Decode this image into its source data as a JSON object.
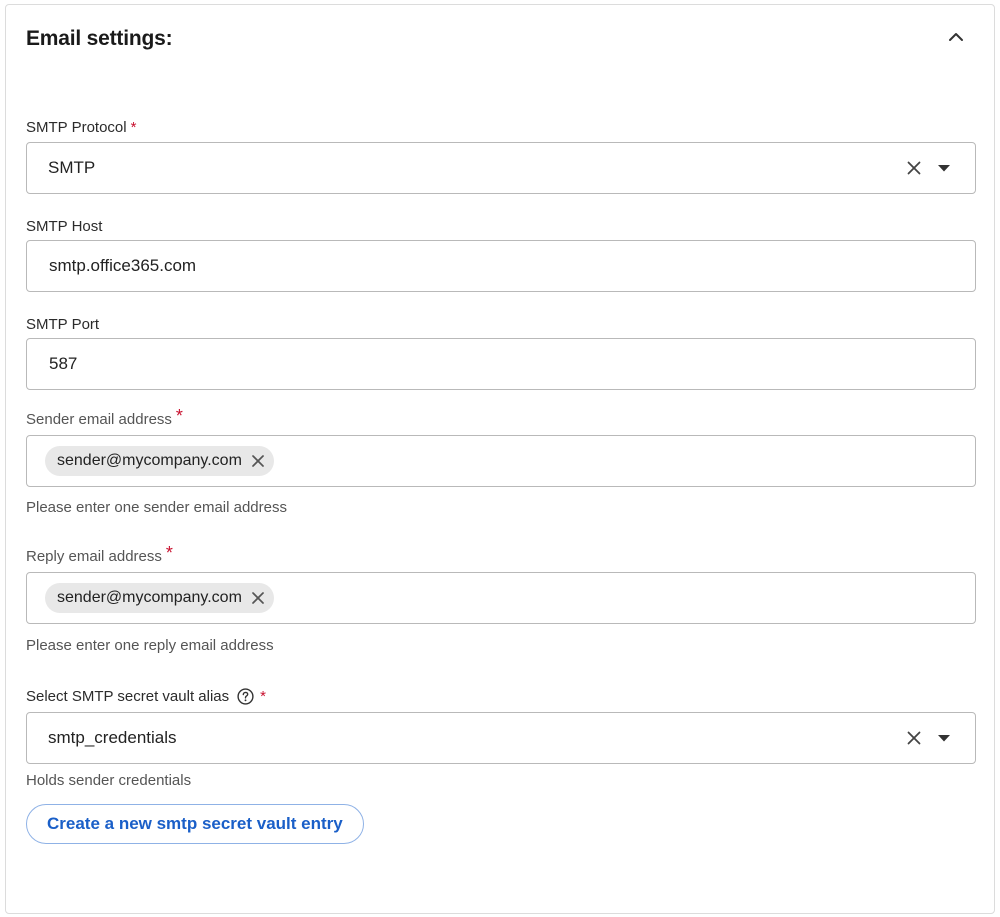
{
  "panel": {
    "title": "Email settings:",
    "collapse_icon": "chevron-up-icon"
  },
  "smtp_protocol": {
    "label": "SMTP Protocol",
    "required_mark": "*",
    "value": "SMTP"
  },
  "smtp_host": {
    "label": "SMTP Host",
    "value": "smtp.office365.com"
  },
  "smtp_port": {
    "label": "SMTP Port",
    "value": "587"
  },
  "sender_email": {
    "label": "Sender email address",
    "required_mark": "*",
    "chip": "sender@mycompany.com",
    "hint": "Please enter one sender email address"
  },
  "reply_email": {
    "label": "Reply email address",
    "required_mark": "*",
    "chip": "sender@mycompany.com",
    "hint": "Please enter one reply email address"
  },
  "vault_alias": {
    "label": "Select SMTP secret vault alias",
    "help_icon": "question-circle-icon",
    "required_mark": "*",
    "value": "smtp_credentials",
    "hint": "Holds sender credentials"
  },
  "create_button": {
    "label": "Create a new smtp secret vault entry"
  },
  "colors": {
    "required": "#c8102e",
    "link_blue": "#1a5fc8",
    "chip_bg": "#e8e8e8",
    "border": "#b9b9b9"
  }
}
